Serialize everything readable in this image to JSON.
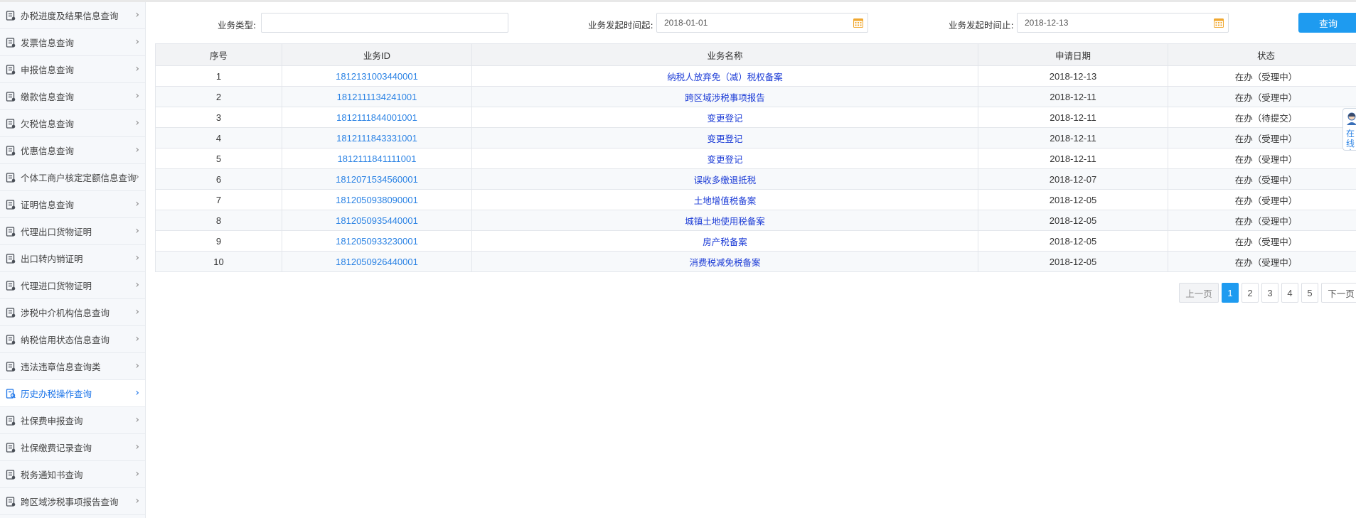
{
  "sidebar": {
    "items": [
      {
        "label": "办税进度及结果信息查询",
        "icon": "document-chart-icon"
      },
      {
        "label": "发票信息查询",
        "icon": "invoice-list-icon"
      },
      {
        "label": "申报信息查询",
        "icon": "box-stack-icon"
      },
      {
        "label": "缴款信息查询",
        "icon": "payment-document-icon"
      },
      {
        "label": "欠税信息查询",
        "icon": "tax-arrears-icon"
      },
      {
        "label": "优惠信息查询",
        "icon": "discount-gift-icon"
      },
      {
        "label": "个体工商户核定定额信息查询",
        "icon": "business-document-icon"
      },
      {
        "label": "证明信息查询",
        "icon": "certificate-icon"
      },
      {
        "label": "代理出口货物证明",
        "icon": "export-document-icon"
      },
      {
        "label": "出口转内销证明",
        "icon": "transfer-document-icon"
      },
      {
        "label": "代理进口货物证明",
        "icon": "import-document-icon"
      },
      {
        "label": "涉税中介机构信息查询",
        "icon": "agency-search-icon"
      },
      {
        "label": "纳税信用状态信息查询",
        "icon": "credit-search-icon"
      },
      {
        "label": "违法违章信息查询类",
        "icon": "violation-list-icon"
      },
      {
        "label": "历史办税操作查询",
        "icon": "history-search-icon",
        "active": true
      },
      {
        "label": "社保费申报查询",
        "icon": "person-search-icon"
      },
      {
        "label": "社保缴费记录查询",
        "icon": "magnifier-square-icon"
      },
      {
        "label": "税务通知书查询",
        "icon": "location-pin-icon"
      },
      {
        "label": "跨区域涉税事项报告查询",
        "icon": "id-card-icon"
      }
    ]
  },
  "filters": {
    "type_label": "业务类型:",
    "type_value": "",
    "start_label": "业务发起时间起:",
    "start_value": "2018-01-01",
    "end_label": "业务发起时间止:",
    "end_value": "2018-12-13",
    "search_label": "查询"
  },
  "table": {
    "headers": [
      "序号",
      "业务ID",
      "业务名称",
      "申请日期",
      "状态"
    ],
    "rows": [
      {
        "no": "1",
        "id": "1812131003440001",
        "name": "纳税人放弃免（减）税权备案",
        "date": "2018-12-13",
        "status": "在办（受理中）"
      },
      {
        "no": "2",
        "id": "1812111134241001",
        "name": "跨区域涉税事项报告",
        "date": "2018-12-11",
        "status": "在办（受理中）"
      },
      {
        "no": "3",
        "id": "1812111844001001",
        "name": "变更登记",
        "date": "2018-12-11",
        "status": "在办（待提交）"
      },
      {
        "no": "4",
        "id": "1812111843331001",
        "name": "变更登记",
        "date": "2018-12-11",
        "status": "在办（受理中）"
      },
      {
        "no": "5",
        "id": "1812111841111001",
        "name": "变更登记",
        "date": "2018-12-11",
        "status": "在办（受理中）"
      },
      {
        "no": "6",
        "id": "1812071534560001",
        "name": "误收多缴退抵税",
        "date": "2018-12-07",
        "status": "在办（受理中）"
      },
      {
        "no": "7",
        "id": "1812050938090001",
        "name": "土地增值税备案",
        "date": "2018-12-05",
        "status": "在办（受理中）"
      },
      {
        "no": "8",
        "id": "1812050935440001",
        "name": "城镇土地使用税备案",
        "date": "2018-12-05",
        "status": "在办（受理中）"
      },
      {
        "no": "9",
        "id": "1812050933230001",
        "name": "房产税备案",
        "date": "2018-12-05",
        "status": "在办（受理中）"
      },
      {
        "no": "10",
        "id": "1812050926440001",
        "name": "消费税减免税备案",
        "date": "2018-12-05",
        "status": "在办（受理中）"
      }
    ]
  },
  "pagination": {
    "prev": "上一页",
    "pages": [
      "1",
      "2",
      "3",
      "4",
      "5"
    ],
    "current": "1",
    "next": "下一页"
  },
  "service_widget": {
    "text": "在线客",
    "icon": "customer-service-icon"
  },
  "colors": {
    "accent": "#1e9bf0",
    "link": "#2a82e4",
    "name_link": "#1a3ad6",
    "calendar": "#f0a830"
  }
}
